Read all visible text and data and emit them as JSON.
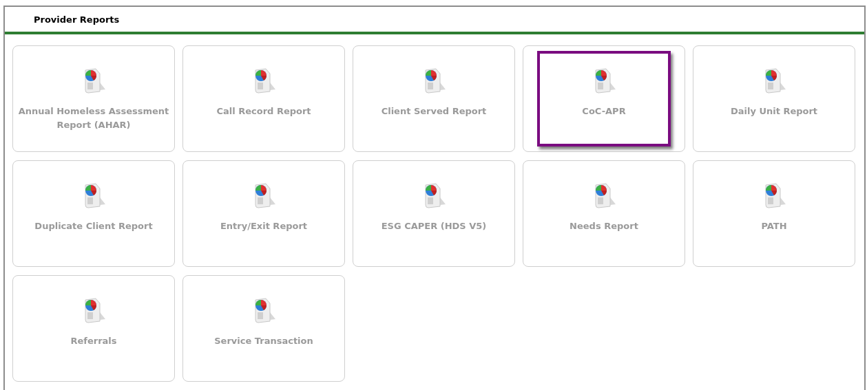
{
  "panel": {
    "title": "Provider Reports"
  },
  "reports": [
    {
      "label": "Annual Homeless Assessment Report (AHAR)",
      "highlighted": false
    },
    {
      "label": "Call Record Report",
      "highlighted": false
    },
    {
      "label": "Client Served Report",
      "highlighted": false
    },
    {
      "label": "CoC-APR",
      "highlighted": true
    },
    {
      "label": "Daily Unit Report",
      "highlighted": false
    },
    {
      "label": "Duplicate Client Report",
      "highlighted": false
    },
    {
      "label": "Entry/Exit Report",
      "highlighted": false
    },
    {
      "label": "ESG CAPER (HDS V5)",
      "highlighted": false
    },
    {
      "label": "Needs Report",
      "highlighted": false
    },
    {
      "label": "PATH",
      "highlighted": false
    },
    {
      "label": "Referrals",
      "highlighted": false
    },
    {
      "label": "Service Transaction",
      "highlighted": false
    }
  ]
}
